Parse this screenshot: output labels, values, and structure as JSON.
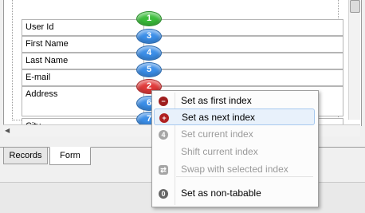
{
  "form": {
    "fields": [
      {
        "label": "User Id",
        "badge": "1",
        "color": "green"
      },
      {
        "label": "First Name",
        "badge": "3",
        "color": "blue"
      },
      {
        "label": "Last Name",
        "badge": "4",
        "color": "blue"
      },
      {
        "label": "E-mail",
        "badge": "5",
        "color": "blue"
      },
      {
        "label": "Address",
        "badge": "2",
        "color": "red"
      },
      {
        "label": "City",
        "badge": "7",
        "color": "blue"
      }
    ],
    "extra_badge": "6"
  },
  "tabs": [
    {
      "label": "Records",
      "active": false
    },
    {
      "label": "Form",
      "active": true
    }
  ],
  "context_menu": {
    "items": [
      {
        "label": "Set as first index",
        "icon": "minus-badge-icon",
        "enabled": true,
        "highlighted": false
      },
      {
        "label": "Set as next index",
        "icon": "plus-badge-icon",
        "enabled": true,
        "highlighted": true
      },
      {
        "label": "Set current index",
        "icon": "number-badge-icon",
        "enabled": false,
        "highlighted": false
      },
      {
        "label": "Shift current index",
        "icon": "",
        "enabled": false,
        "highlighted": false
      },
      {
        "label": "Swap with selected index",
        "icon": "swap-icon",
        "enabled": false,
        "highlighted": false
      },
      {
        "label": "Set as non-tabable",
        "icon": "zero-badge-icon",
        "enabled": true,
        "highlighted": false
      }
    ]
  },
  "colors": {
    "badge_blue": "#3b8ee8",
    "badge_green": "#3bbd3b",
    "badge_red": "#e03a3a",
    "menu_highlight": "#e8f1fb"
  }
}
